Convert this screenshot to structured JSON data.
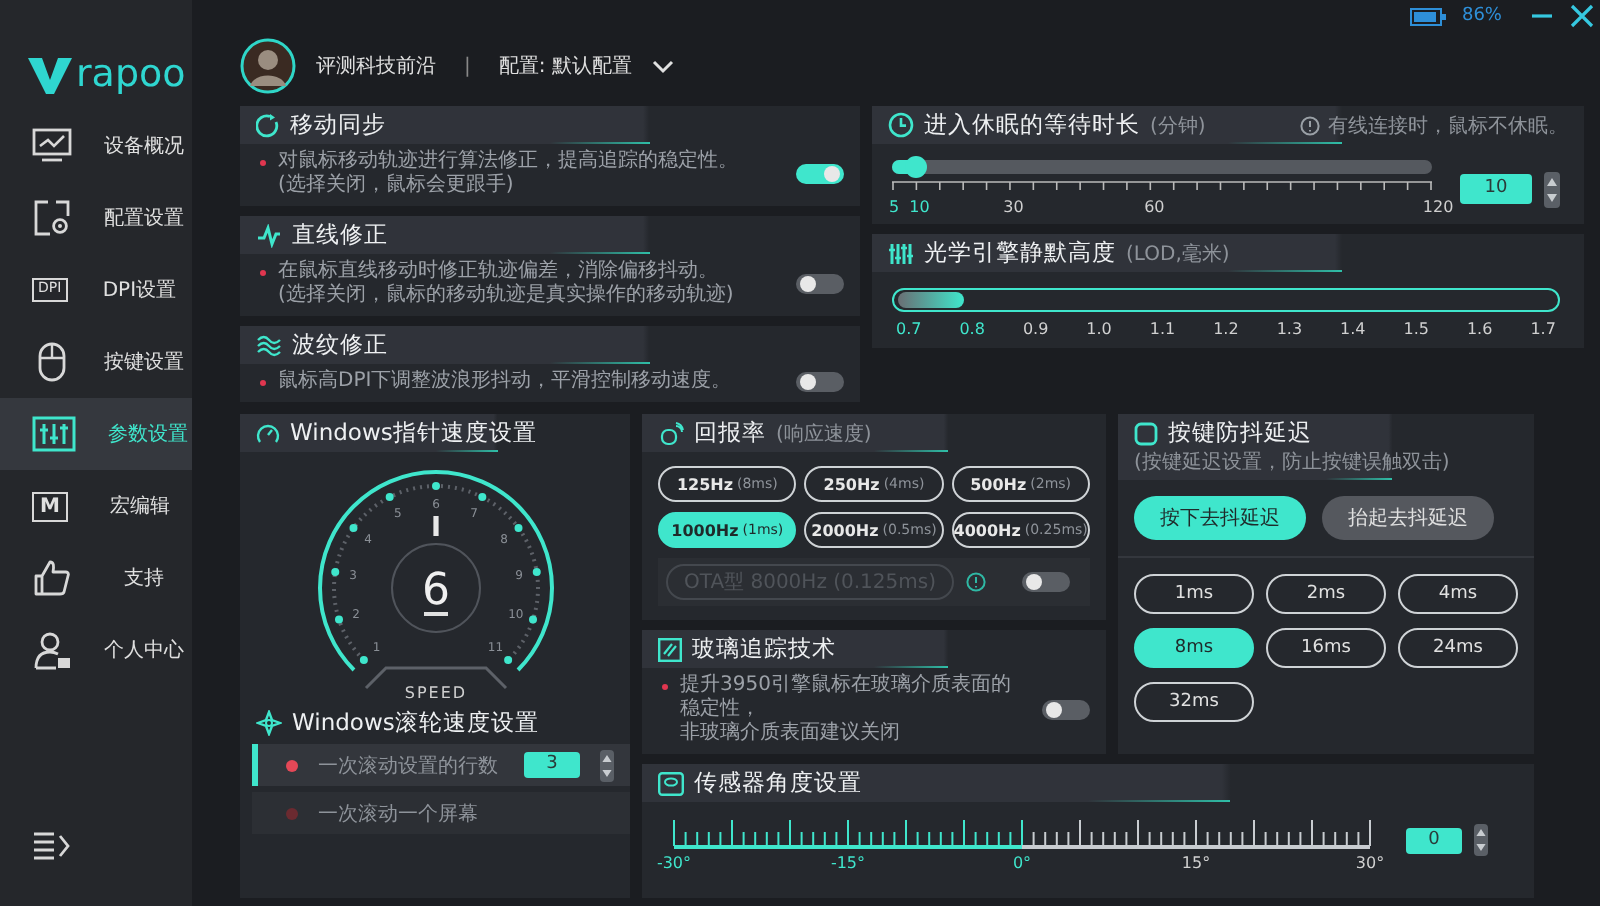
{
  "top_bar": {
    "battery": "86%"
  },
  "logo": {
    "text": "rapoo"
  },
  "sidebar": {
    "items": [
      {
        "label": "设备概况",
        "selected": false
      },
      {
        "label": "配置设置",
        "selected": false
      },
      {
        "label": "DPI设置",
        "selected": false,
        "icon_text": "DPI"
      },
      {
        "label": "按键设置",
        "selected": false
      },
      {
        "label": "参数设置",
        "selected": true
      },
      {
        "label": "宏编辑",
        "selected": false,
        "icon_text": "M"
      },
      {
        "label": "支持",
        "selected": false
      },
      {
        "label": "个人中心",
        "selected": false
      }
    ]
  },
  "header": {
    "user": "评测科技前沿",
    "separator": "|",
    "profile": "配置: 默认配置"
  },
  "switch_cards": [
    {
      "title": "移动同步",
      "description": [
        "对鼠标移动轨迹进行算法修正，提高追踪的稳定性。",
        "(选择关闭，鼠标会更跟手)"
      ],
      "on": true
    },
    {
      "title": "直线修正",
      "description": [
        "在鼠标直线移动时修正轨迹偏差，消除偏移抖动。",
        "(选择关闭，鼠标的移动轨迹是真实操作的移动轨迹)"
      ],
      "on": false
    },
    {
      "title": "波纹修正",
      "description": [
        "鼠标高DPI下调整波浪形抖动，平滑控制移动速度。"
      ],
      "on": false
    }
  ],
  "sleep": {
    "title": "进入休眠的等待时长",
    "unit": "(分钟)",
    "note": "有线连接时，鼠标不休眠。",
    "level": 0.043,
    "value": "10",
    "ticks": [
      "5",
      "10",
      "30",
      "60",
      "120"
    ]
  },
  "lod": {
    "title": "光学引擎静默高度",
    "unit": "(LOD,毫米)",
    "level": 0.1,
    "ticks": [
      "0.7",
      "0.8",
      "0.9",
      "1.0",
      "1.1",
      "1.2",
      "1.3",
      "1.4",
      "1.5",
      "1.6",
      "1.7"
    ]
  },
  "pointer_speed": {
    "title": "Windows指针速度设置",
    "value": "6",
    "level": 0.5,
    "ticks": [
      "1",
      "2",
      "3",
      "4",
      "5",
      "6",
      "7",
      "8",
      "9",
      "10",
      "11"
    ],
    "caption": "SPEED"
  },
  "scroll_speed": {
    "title": "Windows滚轮速度设置",
    "options": [
      {
        "label": "一次滚动设置的行数",
        "selected": true,
        "value": "3"
      },
      {
        "label": "一次滚动一个屏幕",
        "selected": false
      }
    ]
  },
  "polling_rate": {
    "title": "回报率",
    "unit": "(响应速度)",
    "options": [
      {
        "rate": "125Hz",
        "latency": "(8ms)",
        "selected": false
      },
      {
        "rate": "250Hz",
        "latency": "(4ms)",
        "selected": false
      },
      {
        "rate": "500Hz",
        "latency": "(2ms)",
        "selected": false
      },
      {
        "rate": "1000Hz",
        "latency": "(1ms)",
        "selected": true
      },
      {
        "rate": "2000Hz",
        "latency": "(0.5ms)",
        "selected": false
      },
      {
        "rate": "4000Hz",
        "latency": "(0.25ms)",
        "selected": false
      }
    ],
    "ota": {
      "label": "OTA型 8000Hz (0.125ms)",
      "disabled": true,
      "on": false
    }
  },
  "glass_tracking": {
    "title": "玻璃追踪技术",
    "description": [
      "提升3950引擎鼠标在玻璃介质表面的稳定性，",
      "非玻璃介质表面建议关闭"
    ],
    "on": false
  },
  "debounce": {
    "title": "按键防抖延迟",
    "unit": "(按键延迟设置，防止按键误触双击)",
    "modes": [
      {
        "label": "按下去抖延迟",
        "selected": true
      },
      {
        "label": "抬起去抖延迟",
        "selected": false
      }
    ],
    "options": [
      {
        "label": "1ms",
        "selected": false
      },
      {
        "label": "2ms",
        "selected": false
      },
      {
        "label": "4ms",
        "selected": false
      },
      {
        "label": "8ms",
        "selected": true
      },
      {
        "label": "16ms",
        "selected": false
      },
      {
        "label": "24ms",
        "selected": false
      },
      {
        "label": "32ms",
        "selected": false
      }
    ]
  },
  "sensor_angle": {
    "title": "传感器角度设置",
    "level": 0.5,
    "ticks": [
      "-30°",
      "-15°",
      "0°",
      "15°",
      "30°"
    ],
    "value": "0"
  }
}
